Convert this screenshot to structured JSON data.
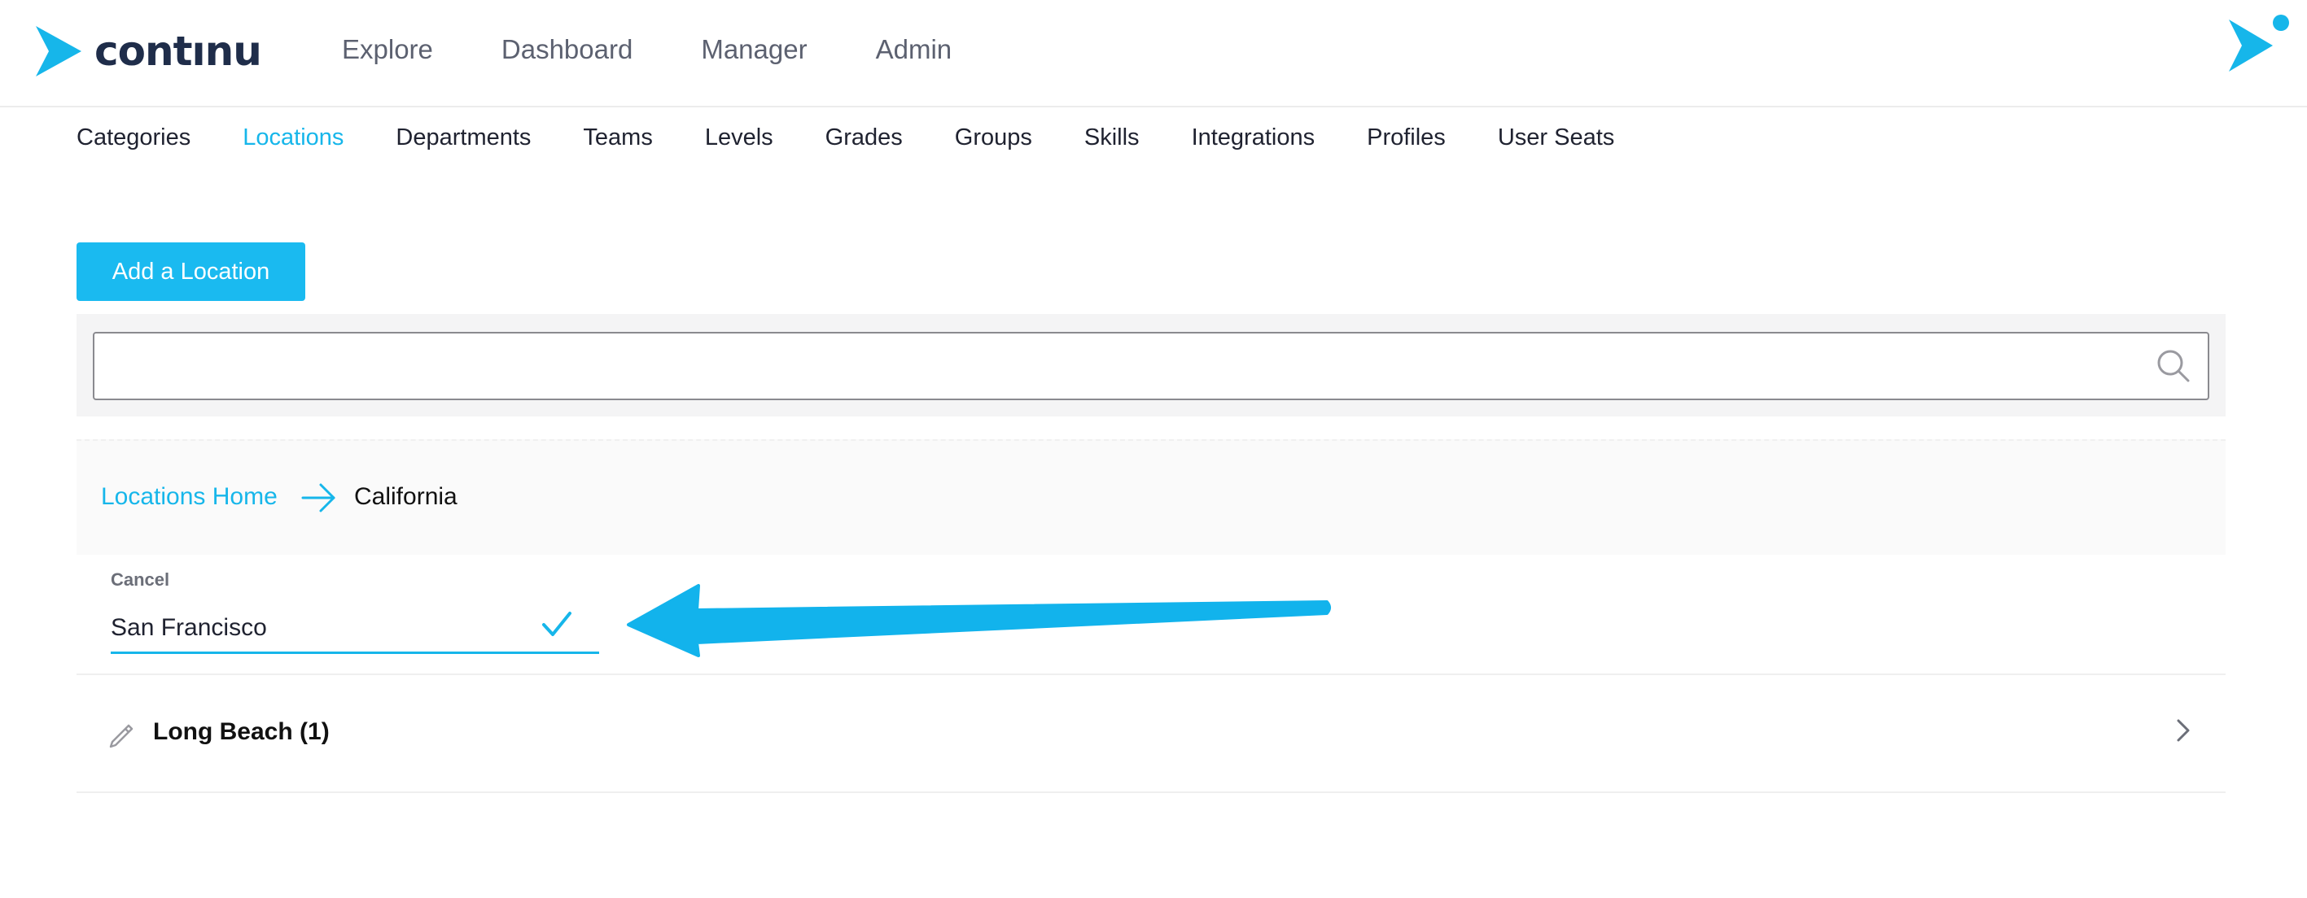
{
  "app": {
    "logo_text": "contınu",
    "main_nav": [
      "Explore",
      "Dashboard",
      "Manager",
      "Admin"
    ]
  },
  "admin_tabs": {
    "items": [
      "Categories",
      "Locations",
      "Departments",
      "Teams",
      "Levels",
      "Grades",
      "Groups",
      "Skills",
      "Integrations",
      "Profiles",
      "User Seats"
    ],
    "active": "Locations"
  },
  "toolbar": {
    "add_label": "Add a Location"
  },
  "search": {
    "value": "",
    "placeholder": ""
  },
  "breadcrumb": {
    "home": "Locations Home",
    "current": "California"
  },
  "edit_location": {
    "cancel_label": "Cancel",
    "value": "San Francisco"
  },
  "locations": [
    {
      "label": "Long Beach (1)"
    }
  ],
  "icons": {
    "logo": "continu-arrow-icon",
    "user": "user-mark-icon",
    "search": "search-icon",
    "breadcrumb_separator": "arrow-right-icon",
    "confirm": "checkmark-icon",
    "edit": "pencil-icon",
    "expand": "chevron-right-icon"
  },
  "colors": {
    "accent": "#16b6ea",
    "button": "#1abaf0",
    "brand_text": "#1f2d4a",
    "nav_text": "#5c6170"
  }
}
